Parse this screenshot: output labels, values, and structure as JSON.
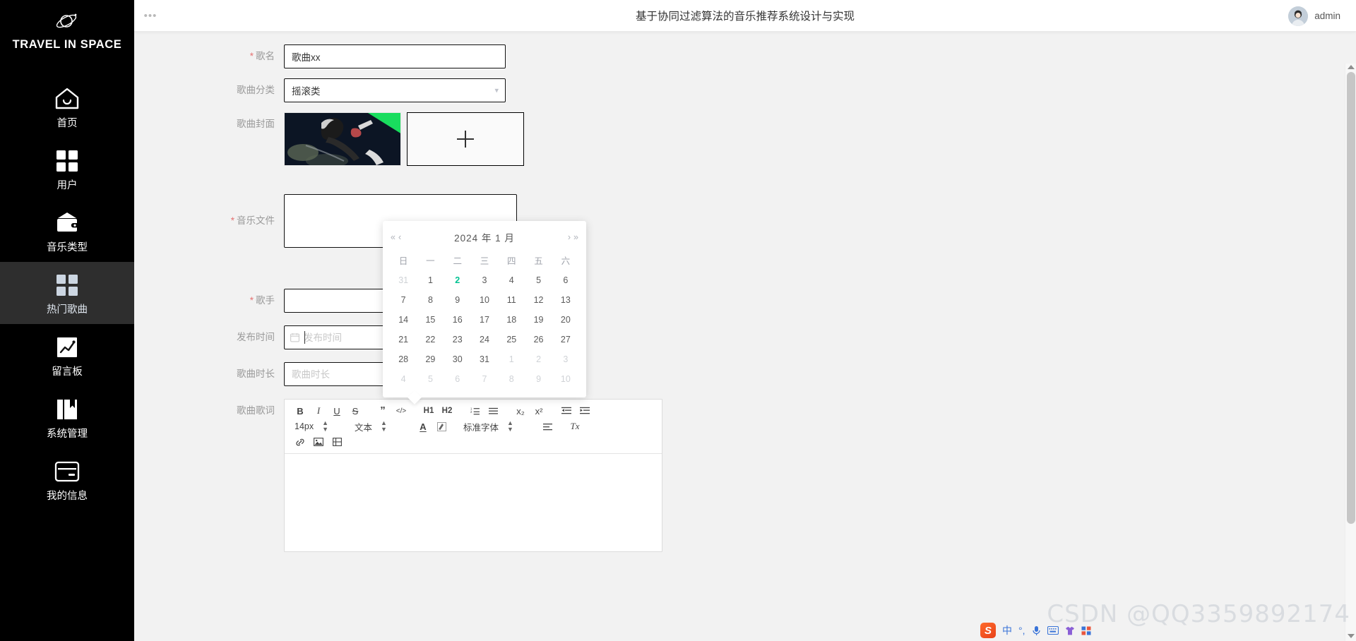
{
  "brand": {
    "name": "TRAVEL IN SPACE",
    "logo_icon": "planet-icon"
  },
  "sidebar": {
    "items": [
      {
        "label": "首页",
        "icon": "home-icon",
        "active": false
      },
      {
        "label": "用户",
        "icon": "grid-icon",
        "active": false
      },
      {
        "label": "音乐类型",
        "icon": "wallet-icon",
        "active": false
      },
      {
        "label": "热门歌曲",
        "icon": "grid-filled-icon",
        "active": true
      },
      {
        "label": "留言板",
        "icon": "chart-line-icon",
        "active": false
      },
      {
        "label": "系统管理",
        "icon": "book-icon",
        "active": false
      },
      {
        "label": "我的信息",
        "icon": "card-icon",
        "active": false
      }
    ]
  },
  "header": {
    "menu_icon": "ellipsis-icon",
    "title": "基于协同过滤算法的音乐推荐系统设计与实现",
    "username": "admin",
    "avatar_icon": "user-avatar"
  },
  "form": {
    "rows": {
      "song_name": {
        "label": "歌名",
        "required": true,
        "value": "歌曲xx",
        "placeholder": "歌名"
      },
      "song_category": {
        "label": "歌曲分类",
        "required": false,
        "value": "摇滚类",
        "caret_icon": "chevron-down-icon"
      },
      "song_cover": {
        "label": "歌曲封面",
        "required": false,
        "add_icon": "plus-icon"
      },
      "music_file": {
        "label": "音乐文件",
        "required": true
      },
      "singer": {
        "label": "歌手",
        "required": true,
        "value": ""
      },
      "release_time": {
        "label": "发布时间",
        "required": false,
        "value": "",
        "placeholder": "发布时间",
        "icon": "calendar-icon"
      },
      "duration": {
        "label": "歌曲时长",
        "required": false,
        "value": "",
        "placeholder": "歌曲时长"
      },
      "lyrics": {
        "label": "歌曲歌词",
        "required": false
      }
    }
  },
  "editor": {
    "row1": [
      {
        "name": "bold-icon",
        "glyph": "B"
      },
      {
        "name": "italic-icon",
        "glyph": "I"
      },
      {
        "name": "underline-icon",
        "glyph": "U"
      },
      {
        "name": "strikethrough-icon",
        "glyph": "S"
      },
      {
        "name": "blockquote-icon",
        "glyph": "”"
      },
      {
        "name": "code-icon",
        "glyph": "</>"
      },
      {
        "name": "heading-1-icon",
        "glyph": "H1"
      },
      {
        "name": "heading-2-icon",
        "glyph": "H2"
      },
      {
        "name": "ordered-list-icon",
        "glyph": "≔"
      },
      {
        "name": "unordered-list-icon",
        "glyph": "≡"
      },
      {
        "name": "subscript-icon",
        "glyph": "x₂"
      },
      {
        "name": "superscript-icon",
        "glyph": "x²"
      },
      {
        "name": "outdent-icon",
        "glyph": "⇤"
      },
      {
        "name": "indent-icon",
        "glyph": "⇥"
      }
    ],
    "font_size": "14px",
    "text_style": "文本",
    "font_family": "标准字体",
    "color_glyph": "A",
    "highlight_glyph": "▨",
    "align_glyph": "≡",
    "clear_format_glyph": "Tx",
    "row3": [
      {
        "name": "link-icon",
        "glyph": "🔗"
      },
      {
        "name": "image-icon",
        "glyph": "🖼"
      },
      {
        "name": "video-icon",
        "glyph": "🎞"
      }
    ]
  },
  "datepicker": {
    "prev_year_icon": "«",
    "prev_month_icon": "‹",
    "next_month_icon": "›",
    "next_year_icon": "»",
    "title": "2024 年 1 月",
    "year": 2024,
    "month": 1,
    "weekdays": [
      "日",
      "一",
      "二",
      "三",
      "四",
      "五",
      "六"
    ],
    "today": 2,
    "weeks": [
      [
        {
          "d": "31",
          "o": true
        },
        {
          "d": "1"
        },
        {
          "d": "2",
          "today": true
        },
        {
          "d": "3"
        },
        {
          "d": "4"
        },
        {
          "d": "5"
        },
        {
          "d": "6"
        }
      ],
      [
        {
          "d": "7"
        },
        {
          "d": "8"
        },
        {
          "d": "9"
        },
        {
          "d": "10"
        },
        {
          "d": "11"
        },
        {
          "d": "12"
        },
        {
          "d": "13"
        }
      ],
      [
        {
          "d": "14"
        },
        {
          "d": "15"
        },
        {
          "d": "16"
        },
        {
          "d": "17"
        },
        {
          "d": "18"
        },
        {
          "d": "19"
        },
        {
          "d": "20"
        }
      ],
      [
        {
          "d": "21"
        },
        {
          "d": "22"
        },
        {
          "d": "23"
        },
        {
          "d": "24"
        },
        {
          "d": "25"
        },
        {
          "d": "26"
        },
        {
          "d": "27"
        }
      ],
      [
        {
          "d": "28"
        },
        {
          "d": "29"
        },
        {
          "d": "30"
        },
        {
          "d": "31"
        },
        {
          "d": "1",
          "o": true
        },
        {
          "d": "2",
          "o": true
        },
        {
          "d": "3",
          "o": true
        }
      ],
      [
        {
          "d": "4",
          "o": true
        },
        {
          "d": "5",
          "o": true
        },
        {
          "d": "6",
          "o": true
        },
        {
          "d": "7",
          "o": true
        },
        {
          "d": "8",
          "o": true
        },
        {
          "d": "9",
          "o": true
        },
        {
          "d": "10",
          "o": true
        }
      ]
    ]
  },
  "watermark": {
    "text": "CSDN @QQ3359892174"
  },
  "ime": {
    "logo": "S",
    "items": [
      {
        "name": "ime-mode-chinese",
        "glyph": "中"
      },
      {
        "name": "ime-punctuation",
        "glyph": "°,"
      },
      {
        "name": "ime-voice-icon",
        "glyph": "🎤"
      },
      {
        "name": "ime-keyboard-icon",
        "glyph": "⌨"
      },
      {
        "name": "ime-skin-icon",
        "glyph": "👕"
      },
      {
        "name": "ime-apps-icon",
        "glyph": "⣿"
      }
    ]
  },
  "colors": {
    "sidebar_bg": "#000000",
    "active_item": "#2e2e2e",
    "today_green": "#00c292",
    "required_red": "#e57373"
  }
}
